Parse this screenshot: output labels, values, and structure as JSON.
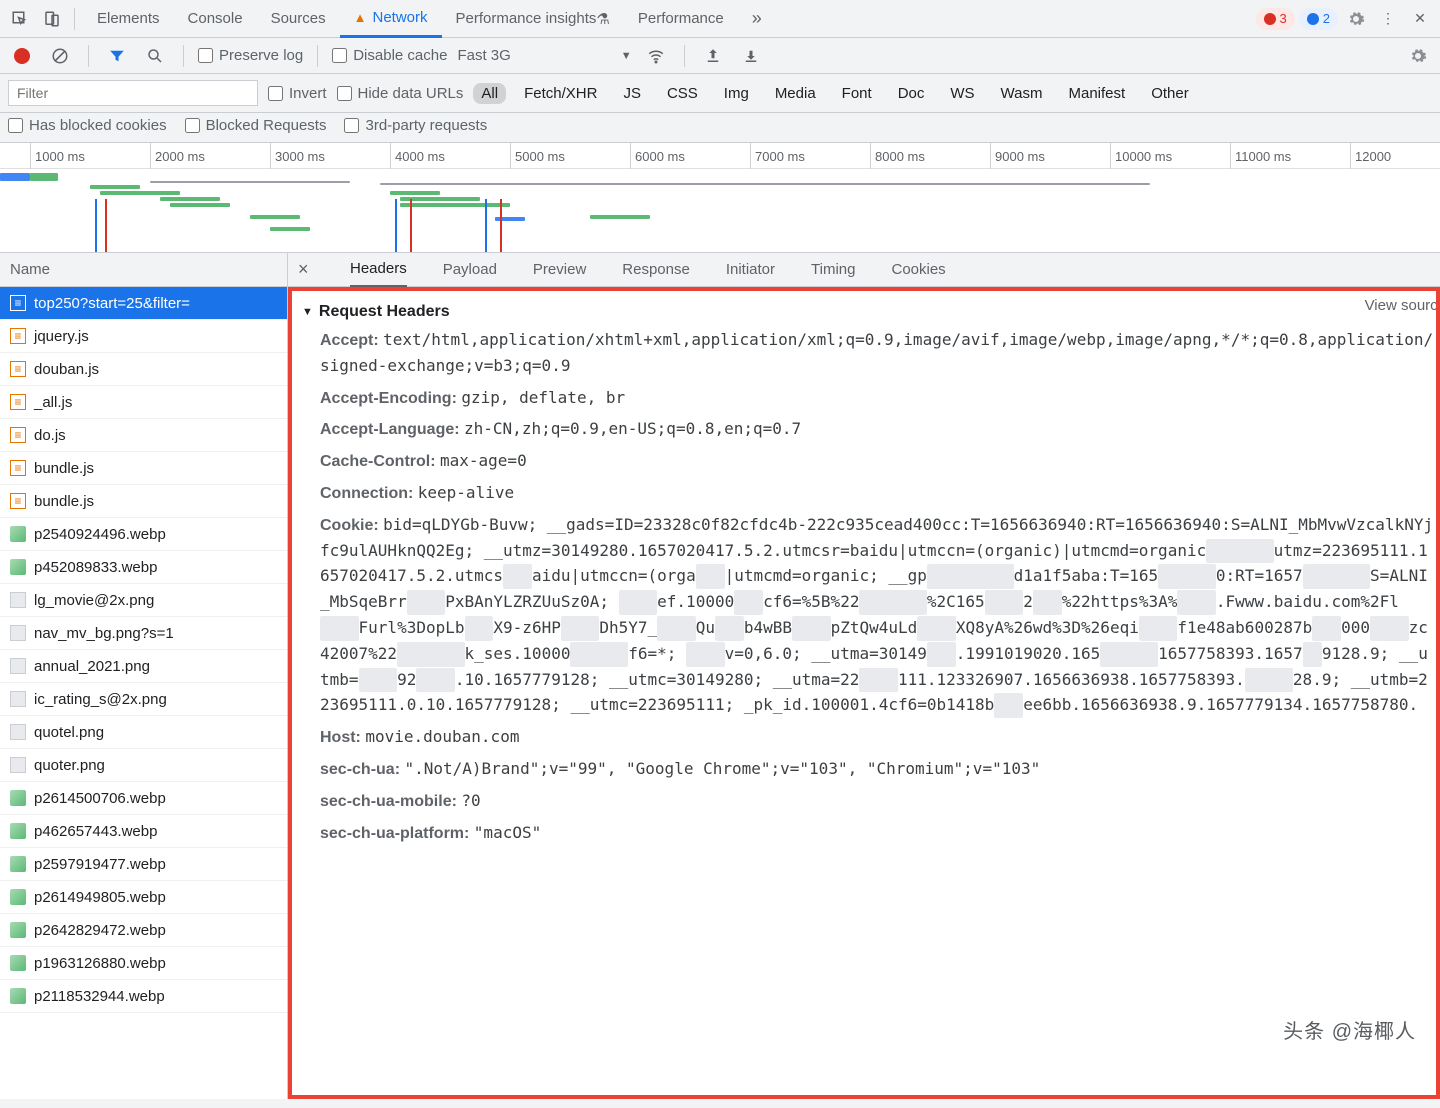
{
  "tabs": {
    "items": [
      "Elements",
      "Console",
      "Sources",
      "Network",
      "Performance insights",
      "Performance"
    ],
    "active_index": 3,
    "warn_index": 3,
    "insights_flask_index": 4
  },
  "badges": {
    "errors": "3",
    "warnings": "2"
  },
  "toolbar": {
    "preserve_log": "Preserve log",
    "disable_cache": "Disable cache",
    "throttle": "Fast 3G"
  },
  "filter": {
    "placeholder": "Filter",
    "invert": "Invert",
    "hide_data_urls": "Hide data URLs",
    "types": [
      "All",
      "Fetch/XHR",
      "JS",
      "CSS",
      "Img",
      "Media",
      "Font",
      "Doc",
      "WS",
      "Wasm",
      "Manifest",
      "Other"
    ],
    "blocked_cookies": "Has blocked cookies",
    "blocked_requests": "Blocked Requests",
    "third_party": "3rd-party requests"
  },
  "timeline": {
    "ticks": [
      "1000 ms",
      "2000 ms",
      "3000 ms",
      "4000 ms",
      "5000 ms",
      "6000 ms",
      "7000 ms",
      "8000 ms",
      "9000 ms",
      "10000 ms",
      "11000 ms",
      "12000"
    ]
  },
  "left": {
    "header": "Name",
    "items": [
      {
        "label": "top250?start=25&filter=",
        "type": "doc",
        "selected": true
      },
      {
        "label": "jquery.js",
        "type": "js"
      },
      {
        "label": "douban.js",
        "type": "js"
      },
      {
        "label": "_all.js",
        "type": "js"
      },
      {
        "label": "do.js",
        "type": "js"
      },
      {
        "label": "bundle.js",
        "type": "js"
      },
      {
        "label": "bundle.js",
        "type": "js"
      },
      {
        "label": "p2540924496.webp",
        "type": "img"
      },
      {
        "label": "p452089833.webp",
        "type": "img"
      },
      {
        "label": "lg_movie@2x.png",
        "type": "png"
      },
      {
        "label": "nav_mv_bg.png?s=1",
        "type": "png"
      },
      {
        "label": "annual_2021.png",
        "type": "png"
      },
      {
        "label": "ic_rating_s@2x.png",
        "type": "png"
      },
      {
        "label": "quotel.png",
        "type": "png"
      },
      {
        "label": "quoter.png",
        "type": "png"
      },
      {
        "label": "p2614500706.webp",
        "type": "img"
      },
      {
        "label": "p462657443.webp",
        "type": "img"
      },
      {
        "label": "p2597919477.webp",
        "type": "img"
      },
      {
        "label": "p2614949805.webp",
        "type": "img"
      },
      {
        "label": "p2642829472.webp",
        "type": "img"
      },
      {
        "label": "p1963126880.webp",
        "type": "img"
      },
      {
        "label": "p2118532944.webp",
        "type": "img"
      }
    ]
  },
  "details": {
    "tabs": [
      "Headers",
      "Payload",
      "Preview",
      "Response",
      "Initiator",
      "Timing",
      "Cookies"
    ],
    "active_index": 0,
    "section_title": "Request Headers",
    "view_source": "View source",
    "headers": [
      {
        "k": "Accept:",
        "v": "text/html,application/xhtml+xml,application/xml;q=0.9,image/avif,image/webp,image/apng,*/*;q=0.8,application/signed-exchange;v=b3;q=0.9"
      },
      {
        "k": "Accept-Encoding:",
        "v": "gzip, deflate, br"
      },
      {
        "k": "Accept-Language:",
        "v": "zh-CN,zh;q=0.9,en-US;q=0.8,en;q=0.7"
      },
      {
        "k": "Cache-Control:",
        "v": "max-age=0"
      },
      {
        "k": "Connection:",
        "v": "keep-alive"
      },
      {
        "k": "Cookie:",
        "v": "bid=qLDYGb-Buvw; __gads=ID=23328c0f82cfdc4b-222c935cead400cc:T=1656636940:RT=1656636940:S=ALNI_MbMvwVzcalkNYjfc9ulAUHknQQ2Eg; __utmz=30149280.1657020417.5.2.utmcsr=baidu|utmccn=(organic)|utmcmd=organic███████utmz=223695111.1657020417.5.2.utmcs███aidu|utmccn=(orga███|utmcmd=organic; __gp█████████d1a1f5aba:T=165██████0:RT=1657███████S=ALNI_MbSqeBrr████PxBAnYLZRZUuSz0A; ████ef.10000███cf6=%5B%22███████%2C165████2███%22https%3A%████.Fwww.baidu.com%2Fl████Furl%3DopLb███X9-z6HP████Dh5Y7_████Qu███b4wBB████pZtQw4uLd████XQ8yA%26wd%3D%26eqi████f1e48ab600287b███000████zc42007%22███████k_ses.10000██████f6=*; ████v=0,6.0; __utma=30149███.1991019020.165██████1657758393.1657██9128.9; __utmb=████92████.10.1657779128; __utmc=30149280; __utma=22████111.123326907.1656636938.1657758393.█████28.9; __utmb=223695111.0.10.1657779128; __utmc=223695111; _pk_id.100001.4cf6=0b1418b███ee6bb.1656636938.9.1657779134.1657758780."
      },
      {
        "k": "Host:",
        "v": "movie.douban.com"
      },
      {
        "k": "sec-ch-ua:",
        "v": "\".Not/A)Brand\";v=\"99\", \"Google Chrome\";v=\"103\", \"Chromium\";v=\"103\""
      },
      {
        "k": "sec-ch-ua-mobile:",
        "v": "?0"
      },
      {
        "k": "sec-ch-ua-platform:",
        "v": "\"macOS\""
      }
    ]
  },
  "watermark": "头条 @海椰人"
}
